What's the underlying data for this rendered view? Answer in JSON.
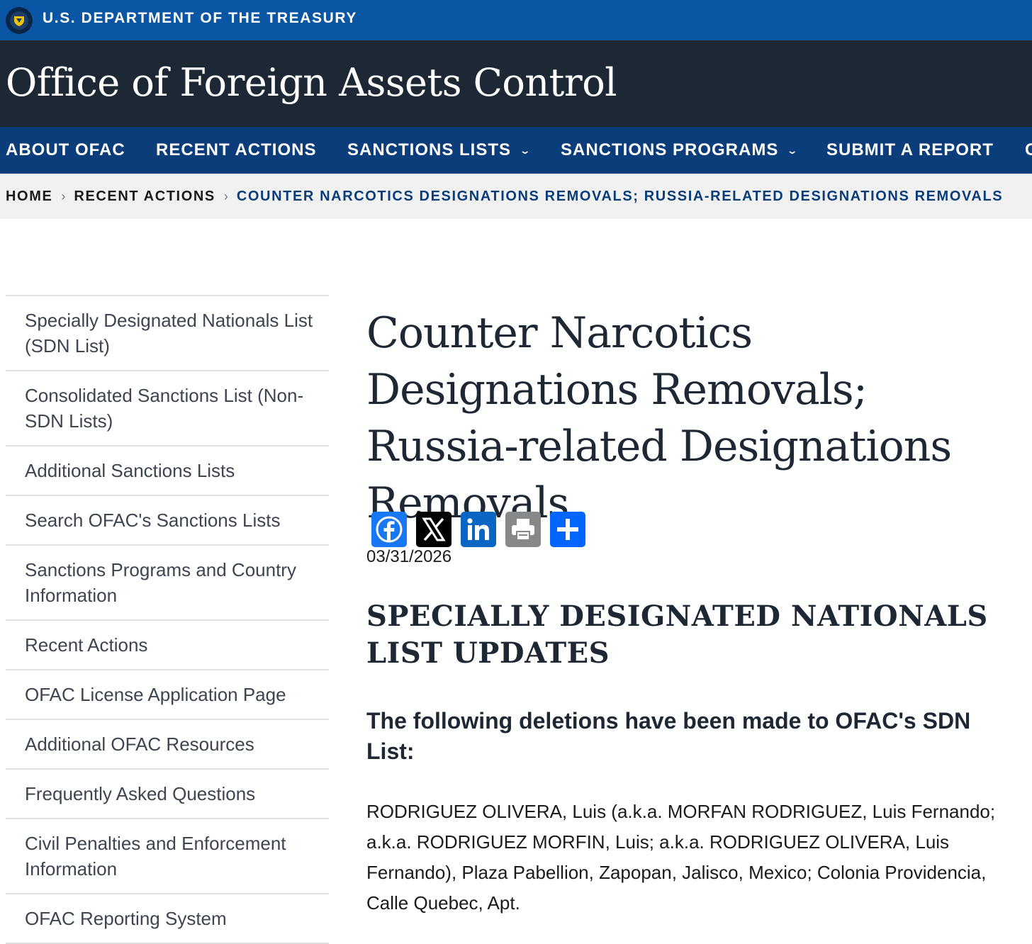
{
  "topbar": {
    "title": "U.S. DEPARTMENT OF THE TREASURY"
  },
  "site": {
    "title": "Office of Foreign Assets Control"
  },
  "nav": {
    "items": [
      {
        "label": "ABOUT OFAC"
      },
      {
        "label": "RECENT ACTIONS"
      },
      {
        "label": "SANCTIONS LISTS"
      },
      {
        "label": "SANCTIONS PROGRAMS"
      },
      {
        "label": "SUBMIT A REPORT"
      },
      {
        "label": "C"
      }
    ]
  },
  "breadcrumb": {
    "home": "HOME",
    "parent": "RECENT ACTIONS",
    "current": "COUNTER NARCOTICS DESIGNATIONS REMOVALS; RUSSIA-RELATED DESIGNATIONS REMOVALS"
  },
  "sidebar": {
    "items": [
      {
        "label": "Specially Designated Nationals List (SDN List)"
      },
      {
        "label": "Consolidated Sanctions List (Non-SDN Lists)"
      },
      {
        "label": "Additional Sanctions Lists"
      },
      {
        "label": "Search OFAC's Sanctions Lists"
      },
      {
        "label": "Sanctions Programs and Country Information"
      },
      {
        "label": "Recent Actions"
      },
      {
        "label": "OFAC License Application Page"
      },
      {
        "label": "Additional OFAC Resources"
      },
      {
        "label": "Frequently Asked Questions"
      },
      {
        "label": "Civil Penalties and Enforcement Information"
      },
      {
        "label": "OFAC Reporting System"
      }
    ]
  },
  "main": {
    "title": "Counter Narcotics Designations Removals; Russia-related Designations Removals",
    "date": "03/31/2026",
    "section_heading": "SPECIALLY DESIGNATED NATIONALS LIST UPDATES",
    "sub_heading": "The following deletions have been made to OFAC's SDN List:",
    "entry": "RODRIGUEZ OLIVERA, Luis (a.k.a. MORFAN RODRIGUEZ, Luis Fernando; a.k.a. RODRIGUEZ MORFIN, Luis; a.k.a. RODRIGUEZ OLIVERA, Luis Fernando), Plaza Pabellion, Zapopan, Jalisco, Mexico; Colonia Providencia, Calle Quebec, Apt."
  },
  "share": {
    "buttons": [
      {
        "icon": "facebook-icon",
        "color": "#1877f2"
      },
      {
        "icon": "x-icon",
        "color": "#000000"
      },
      {
        "icon": "linkedin-icon",
        "color": "#0a66c2"
      },
      {
        "icon": "print-icon",
        "color": "#888888"
      },
      {
        "icon": "share-icon",
        "color": "#0166ff"
      }
    ]
  }
}
